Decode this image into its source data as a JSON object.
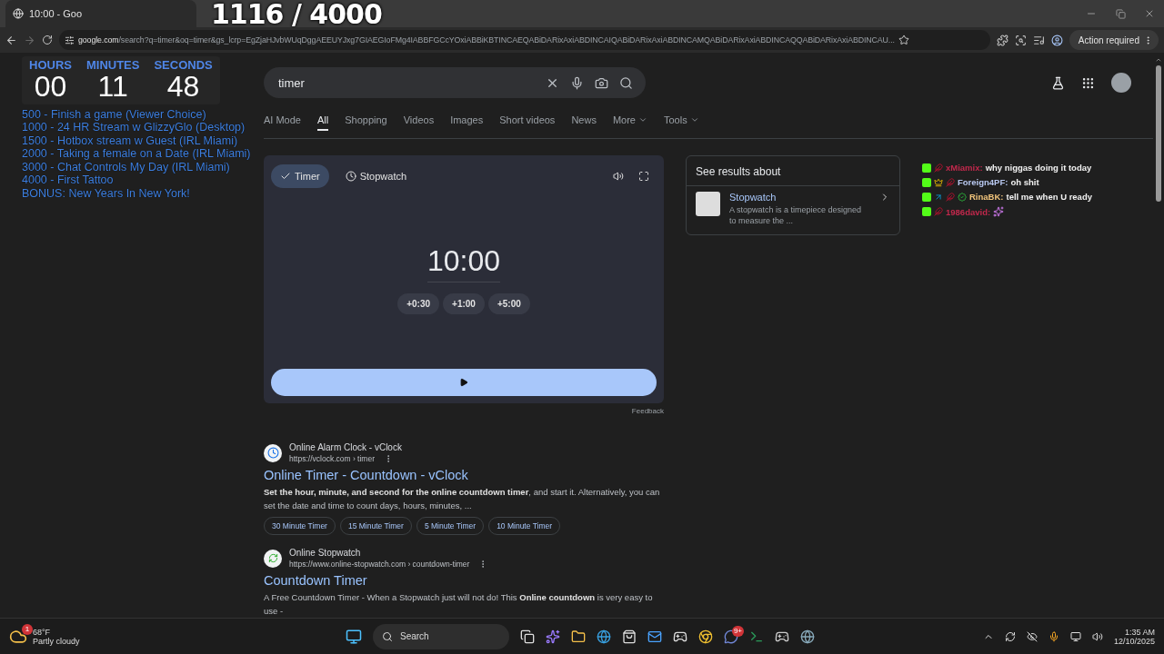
{
  "browser": {
    "tab_title": "10:00 - Goo",
    "address_host": "google.com",
    "address_path": "/search?q=timer&oq=timer&gs_lcrp=EgZjaHJvbWUqDggAEEUYJxg7GIAEGIoFMg4IABBFGCcYOxiABBiKBTINCAEQABiDARixAxiABDINCAIQABiDARixAxiABDINCAMQABiDARixAxiABDINCAQQABiDARixAxiABDINCAU...",
    "action_chip": "Action required"
  },
  "stream_overlay": {
    "goal_counter": "1116 / 4000",
    "countdown": [
      {
        "unit": "HOURS",
        "value": "00"
      },
      {
        "unit": "MINUTES",
        "value": "11"
      },
      {
        "unit": "SECONDS",
        "value": "48"
      }
    ],
    "goals": [
      "500 -  Finish a game (Viewer Choice)",
      "1000 - 24 HR Stream w GlizzyGlo (Desktop)",
      "1500 - Hotbox stream w Guest (IRL Miami)",
      "2000 - Taking a female on a Date (IRL Miami)",
      "3000 - Chat Controls My Day (IRL Miami)",
      "4000 - First Tattoo",
      "BONUS: New Years In New York!"
    ]
  },
  "search": {
    "value": "timer"
  },
  "nav_tabs": [
    {
      "label": "AI Mode",
      "selected": false,
      "kind": "plain"
    },
    {
      "label": "All",
      "selected": true,
      "kind": "plain"
    },
    {
      "label": "Shopping",
      "selected": false,
      "kind": "plain"
    },
    {
      "label": "Videos",
      "selected": false,
      "kind": "plain"
    },
    {
      "label": "Images",
      "selected": false,
      "kind": "plain"
    },
    {
      "label": "Short videos",
      "selected": false,
      "kind": "plain"
    },
    {
      "label": "News",
      "selected": false,
      "kind": "plain"
    },
    {
      "label": "More",
      "selected": false,
      "kind": "menu"
    },
    {
      "label": "Tools",
      "selected": false,
      "kind": "menu"
    }
  ],
  "timer_widget": {
    "modes": [
      {
        "label": "Timer",
        "selected": true,
        "kind": "timer"
      },
      {
        "label": "Stopwatch",
        "selected": false,
        "kind": "stopwatch"
      }
    ],
    "time": "10:00",
    "add_buttons": [
      "+0:30",
      "+1:00",
      "+5:00"
    ],
    "feedback": "Feedback"
  },
  "results": [
    {
      "site": "Online Alarm Clock - vClock",
      "url": "https://vclock.com › timer",
      "title": "Online Timer - Countdown - vClock",
      "snippet": "**Set the hour, minute, and second for the online countdown timer**, and start it. Alternatively, you can set the date and time to count days, hours, minutes, ...",
      "links": [
        "30 Minute Timer",
        "15 Minute Timer",
        "5 Minute Timer",
        "10 Minute Timer"
      ]
    },
    {
      "site": "Online Stopwatch",
      "url": "https://www.online-stopwatch.com › countdown-timer",
      "title": "Countdown Timer",
      "snippet": "A Free Countdown Timer - When a Stopwatch just will not do! This **Online countdown** is very easy to use -"
    }
  ],
  "knowledge_panel": {
    "heading": "See results about",
    "entity": "Stopwatch",
    "description": "A stopwatch is a timepiece designed to measure the ..."
  },
  "chat": [
    {
      "user": "xMiamix:",
      "color": "#c2284c",
      "badges": [
        {
          "kind": "kick"
        },
        {
          "kind": "feather"
        }
      ],
      "kind": "text",
      "message": "why niggas doing it today"
    },
    {
      "user": "Foreign4PF:",
      "color": "#b8c8f0",
      "badges": [
        {
          "kind": "kick"
        },
        {
          "kind": "crown"
        },
        {
          "kind": "feather"
        }
      ],
      "kind": "text",
      "message": "oh shit"
    },
    {
      "user": "RinaBK:",
      "color": "#f2c57c",
      "badges": [
        {
          "kind": "kick"
        },
        {
          "kind": "arrow"
        },
        {
          "kind": "feather"
        },
        {
          "kind": "verified"
        }
      ],
      "kind": "text",
      "message": "tell me when U ready"
    },
    {
      "user": "1986david:",
      "color": "#c2284c",
      "badges": [
        {
          "kind": "kick"
        },
        {
          "kind": "feather"
        }
      ],
      "kind": "emote"
    }
  ],
  "taskbar": {
    "weather_badge": "1",
    "temperature": "68°F",
    "condition": "Partly cloudy",
    "search": "Search",
    "discord_badge": "9+",
    "time": "1:35 AM",
    "date": "12/10/2025"
  }
}
